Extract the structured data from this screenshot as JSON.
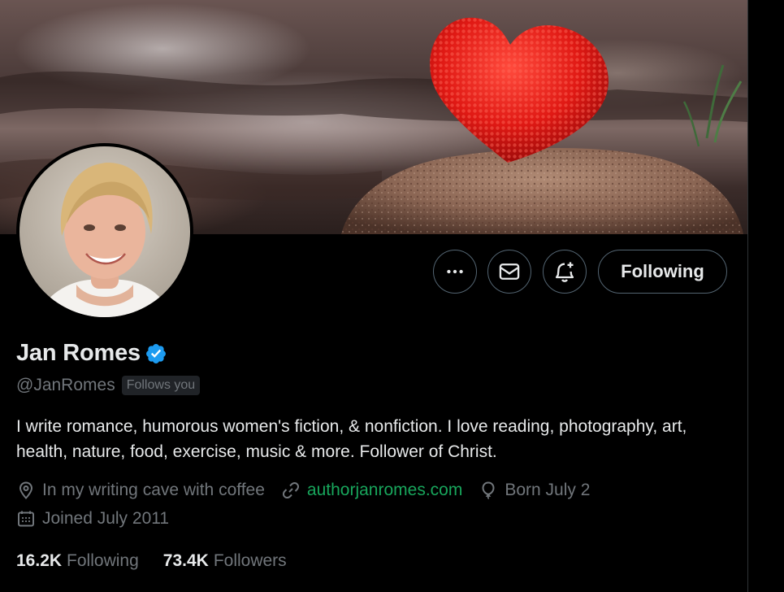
{
  "profile": {
    "display_name": "Jan Romes",
    "handle": "@JanRomes",
    "follows_you_badge": "Follows you",
    "bio": "I write romance, humorous women's fiction, & nonfiction. I love reading, photography, art, health, nature, food, exercise, music & more. Follower of Christ.",
    "location": "In my writing cave with coffee",
    "website": "authorjanromes.com",
    "birthday": "Born July 2",
    "joined": "Joined July 2011"
  },
  "actions": {
    "more_icon": "ellipsis-icon",
    "message_icon": "envelope-icon",
    "notify_icon": "bell-plus-icon",
    "following_label": "Following"
  },
  "stats": {
    "following_count": "16.2K",
    "following_label": "Following",
    "followers_count": "73.4K",
    "followers_label": "Followers"
  },
  "colors": {
    "background": "#000000",
    "text_primary": "#e7e9ea",
    "text_secondary": "#71767b",
    "verified": "#1d9bf0",
    "link": "#18a65c",
    "border": "#536471"
  }
}
